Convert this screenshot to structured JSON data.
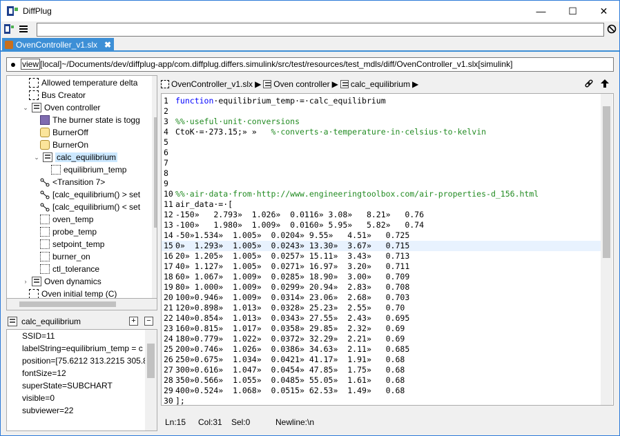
{
  "window": {
    "title": "DiffPlug",
    "minimize": "—",
    "maximize": "☐",
    "close": "✕"
  },
  "tab": {
    "label": "OvenController_v1.slx",
    "close": "✖"
  },
  "path": {
    "view_label": "view",
    "text": "[local]~/Documents/dev/diffplug-app/com.diffplug.differs.simulink/src/test/resources/test_mdls/diff/OvenController_v1.slx[simulink]"
  },
  "tree": {
    "items": [
      {
        "label": "Allowed temperature delta",
        "icon": "block-icon"
      },
      {
        "label": "Bus Creator",
        "icon": "block-icon"
      },
      {
        "label": "Oven controller",
        "icon": "subsystem-icon",
        "twisty": "⌄"
      },
      {
        "label": "The burner state is togg",
        "icon": "cube-icon"
      },
      {
        "label": "BurnerOff",
        "icon": "state-icon"
      },
      {
        "label": "BurnerOn",
        "icon": "state-icon"
      },
      {
        "label": "calc_equilibrium",
        "icon": "chart-icon",
        "twisty": "⌄"
      },
      {
        "label": "equilibrium_temp",
        "icon": "data-icon"
      },
      {
        "label": "<Transition 7>",
        "icon": "transition-icon"
      },
      {
        "label": "[calc_equilibrium() > set",
        "icon": "transition-icon"
      },
      {
        "label": "[calc_equilibrium() < set",
        "icon": "transition-icon"
      },
      {
        "label": "oven_temp",
        "icon": "data-icon"
      },
      {
        "label": "probe_temp",
        "icon": "data-icon"
      },
      {
        "label": "setpoint_temp",
        "icon": "data-icon"
      },
      {
        "label": "burner_on",
        "icon": "data-icon"
      },
      {
        "label": "ctl_tolerance",
        "icon": "data-icon"
      },
      {
        "label": "Oven dynamics",
        "icon": "subsystem-icon",
        "twisty": "›"
      },
      {
        "label": "Oven initial temp (C)",
        "icon": "block-icon"
      }
    ]
  },
  "props": {
    "title": "calc_equilibrium",
    "expand": "+",
    "collapse": "−",
    "rows": [
      "SSID=11",
      "labelString=equilibrium_temp = c",
      "position=[75.6212 313.2215 305.8 8",
      "fontSize=12",
      "superState=SUBCHART",
      "visible=0",
      "subviewer=22"
    ]
  },
  "breadcrumb": {
    "items": [
      "OvenController_v1.slx",
      "Oven controller",
      "calc_equilibrium"
    ],
    "sep": "▶"
  },
  "editor": {
    "lines": [
      {
        "n": "1",
        "kw": "function",
        "text": "·equilibrium_temp·=·calc_equilibrium",
        "cm": ""
      },
      {
        "n": "2",
        "kw": "",
        "text": "",
        "cm": ""
      },
      {
        "n": "3",
        "kw": "",
        "text": "",
        "cm": "%%·useful·unit·conversions"
      },
      {
        "n": "4",
        "kw": "",
        "text": "CtoK·=·273.15;» »   ",
        "cm": "%·converts·a·temperature·in·celsius·to·kelvin"
      },
      {
        "n": "5",
        "kw": "",
        "text": "",
        "cm": ""
      },
      {
        "n": "6",
        "kw": "",
        "text": "",
        "cm": ""
      },
      {
        "n": "7",
        "kw": "",
        "text": "",
        "cm": ""
      },
      {
        "n": "8",
        "kw": "",
        "text": "",
        "cm": ""
      },
      {
        "n": "9",
        "kw": "",
        "text": "",
        "cm": ""
      },
      {
        "n": "10",
        "kw": "",
        "text": "",
        "cm": "%%·air·data·from·http://www.engineeringtoolbox.com/air-properties-d_156.html"
      },
      {
        "n": "11",
        "kw": "",
        "text": "air_data·=·[",
        "cm": ""
      },
      {
        "n": "12",
        "kw": "",
        "text": "-150»   2.793»  1.026»  0.0116» 3.08»   8.21»   0.76",
        "cm": ""
      },
      {
        "n": "13",
        "kw": "",
        "text": "-100»   1.980»  1.009»  0.0160» 5.95»   5.82»   0.74",
        "cm": ""
      },
      {
        "n": "14",
        "kw": "",
        "text": "-50»1.534»  1.005»  0.0204» 9.55»   4.51»   0.725",
        "cm": ""
      },
      {
        "n": "15",
        "kw": "",
        "text": "0»  1.293»  1.005»  0.0243» 13.30»  3.67»   0.715",
        "cm": ""
      },
      {
        "n": "16",
        "kw": "",
        "text": "20» 1.205»  1.005»  0.0257» 15.11»  3.43»   0.713",
        "cm": ""
      },
      {
        "n": "17",
        "kw": "",
        "text": "40» 1.127»  1.005»  0.0271» 16.97»  3.20»   0.711",
        "cm": ""
      },
      {
        "n": "18",
        "kw": "",
        "text": "60» 1.067»  1.009»  0.0285» 18.90»  3.00»   0.709",
        "cm": ""
      },
      {
        "n": "19",
        "kw": "",
        "text": "80» 1.000»  1.009»  0.0299» 20.94»  2.83»   0.708",
        "cm": ""
      },
      {
        "n": "20",
        "kw": "",
        "text": "100»0.946»  1.009»  0.0314» 23.06»  2.68»   0.703",
        "cm": ""
      },
      {
        "n": "21",
        "kw": "",
        "text": "120»0.898»  1.013»  0.0328» 25.23»  2.55»   0.70",
        "cm": ""
      },
      {
        "n": "22",
        "kw": "",
        "text": "140»0.854»  1.013»  0.0343» 27.55»  2.43»   0.695",
        "cm": ""
      },
      {
        "n": "23",
        "kw": "",
        "text": "160»0.815»  1.017»  0.0358» 29.85»  2.32»   0.69",
        "cm": ""
      },
      {
        "n": "24",
        "kw": "",
        "text": "180»0.779»  1.022»  0.0372» 32.29»  2.21»   0.69",
        "cm": ""
      },
      {
        "n": "25",
        "kw": "",
        "text": "200»0.746»  1.026»  0.0386» 34.63»  2.11»   0.685",
        "cm": ""
      },
      {
        "n": "26",
        "kw": "",
        "text": "250»0.675»  1.034»  0.0421» 41.17»  1.91»   0.68",
        "cm": ""
      },
      {
        "n": "27",
        "kw": "",
        "text": "300»0.616»  1.047»  0.0454» 47.85»  1.75»   0.68",
        "cm": ""
      },
      {
        "n": "28",
        "kw": "",
        "text": "350»0.566»  1.055»  0.0485» 55.05»  1.61»   0.68",
        "cm": ""
      },
      {
        "n": "29",
        "kw": "",
        "text": "400»0.524»  1.068»  0.0515» 62.53»  1.49»   0.68",
        "cm": ""
      },
      {
        "n": "30",
        "kw": "",
        "text": "];",
        "cm": ""
      }
    ]
  },
  "status": {
    "ln": "Ln:15",
    "col": "Col:31",
    "sel": "Sel:0",
    "newline": "Newline:\\n"
  }
}
